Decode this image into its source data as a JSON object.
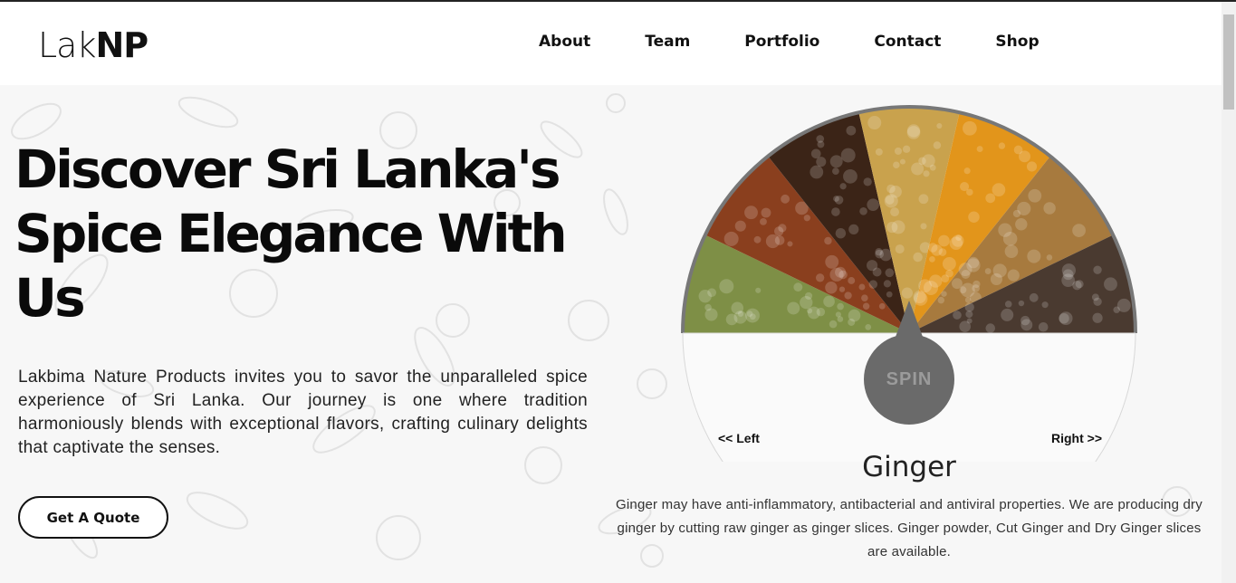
{
  "logo": {
    "light": "Lak",
    "bold": "NP"
  },
  "nav": [
    "About",
    "Team",
    "Portfolio",
    "Contact",
    "Shop"
  ],
  "hero": {
    "title": "Discover Sri Lanka's Spice Elegance With Us",
    "intro": "Lakbima Nature Products invites you to savor the unparalleled spice experience of Sri Lanka. Our journey is one where tradition harmoniously blends with exceptional flavors, crafting culinary delights that captivate the senses.",
    "cta": "Get A Quote"
  },
  "wheel": {
    "spin_label": "SPIN",
    "left_label": "<< Left",
    "right_label": "Right >>",
    "selected_name": "Ginger",
    "selected_desc": "Ginger may have anti-inflammatory, antibacterial and antiviral properties. We are producing dry ginger by cutting raw ginger as ginger slices. Ginger powder, Cut Ginger and Dry Ginger slices are available.",
    "segments": [
      {
        "name": "cardamom-icon",
        "color": "#7e8f46"
      },
      {
        "name": "cinnamon-icon",
        "color": "#8a3f1e"
      },
      {
        "name": "cloves-icon",
        "color": "#3b2417"
      },
      {
        "name": "ginger-icon",
        "color": "#c9a24d"
      },
      {
        "name": "turmeric-icon",
        "color": "#e2951b"
      },
      {
        "name": "pepper-icon",
        "color": "#a77a3e"
      },
      {
        "name": "mustard-icon",
        "color": "#4a3a30"
      }
    ]
  }
}
